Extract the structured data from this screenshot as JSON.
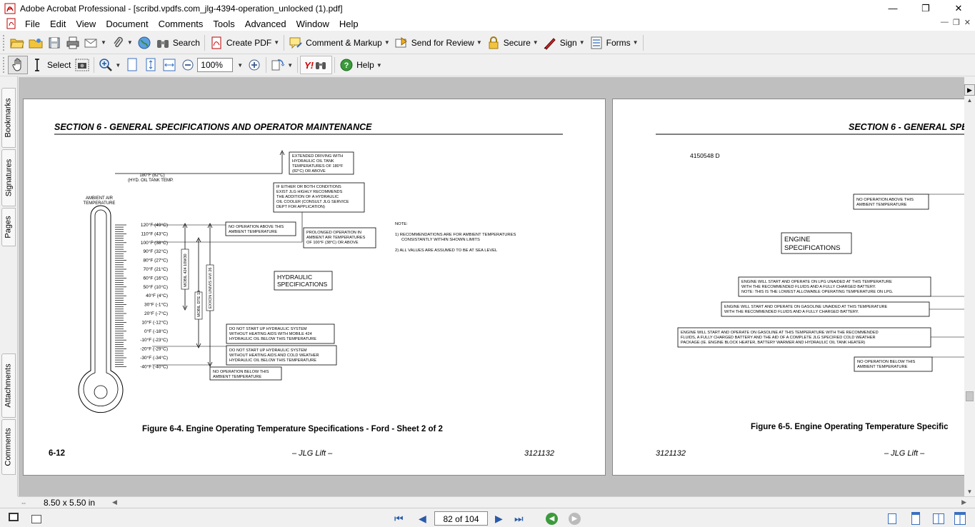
{
  "window": {
    "title": "Adobe Acrobat Professional - [scribd.vpdfs.com_jlg-4394-operation_unlocked (1).pdf]",
    "minimize": "—",
    "maximize": "❐",
    "close": "✕"
  },
  "menu": [
    "File",
    "Edit",
    "View",
    "Document",
    "Comments",
    "Tools",
    "Advanced",
    "Window",
    "Help"
  ],
  "toolbar1": {
    "search": "Search",
    "create_pdf": "Create PDF",
    "comment_markup": "Comment & Markup",
    "send_review": "Send for Review",
    "secure": "Secure",
    "sign": "Sign",
    "forms": "Forms"
  },
  "toolbar2": {
    "select": "Select",
    "zoom": "100%",
    "help": "Help"
  },
  "side_tabs": [
    "Bookmarks",
    "Signatures",
    "Pages",
    "Attachments",
    "Comments"
  ],
  "status": {
    "page_size": "8.50 x 5.50 in",
    "page_indicator": "82 of 104"
  },
  "page_left": {
    "header": "SECTION 6 - GENERAL SPECIFICATIONS AND OPERATOR MAINTENANCE",
    "hyd_temp_line1": "180°F (82°C)",
    "hyd_temp_line2": "(HYD. OIL TANK TEMP.",
    "ambient_label1": "AMBIENT AIR",
    "ambient_label2": "TEMPERATURE",
    "box_extended": [
      "EXTENDED DRIVING WITH",
      "HYDRAULIC OIL TANK",
      "TEMPERATURES OF 180°F",
      "(82°C) OR ABOVE"
    ],
    "box_either": [
      "IF EITHER OR BOTH CONDITIONS",
      "EXIST JLG HIGHLY RECOMMENDS",
      "THE ADDITION OF A HYDRAULIC",
      "OIL COOLER (CONSULT JLG SERVICE",
      "DEPT FOR APPLICATION)"
    ],
    "box_no_op_above": [
      "NO OPERATION ABOVE THIS",
      "AMBIENT TEMPERATURE"
    ],
    "box_prolonged": [
      "PROLONGED OPERATION IN",
      "AMBIENT AIR TEMPERATURES",
      "OF 100°F (38°C) OR ABOVE"
    ],
    "box_hydraulic": [
      "HYDRAULIC",
      "SPECIFICATIONS"
    ],
    "box_mobile424": [
      "DO NOT START UP HYDRAULIC SYSTEM",
      "WITHOUT HEATING AIDS WITH MOBILE 424",
      "HYDRAULIC OIL BELOW THIS TEMPERATURE"
    ],
    "box_coldweather": [
      "DO NOT START UP HYDRAULIC SYSTEM",
      "WITHOUT HEATING AIDS AND COLD WEATHER",
      "HYDRAULIC OIL BELOW THIS TEMPERATURE"
    ],
    "box_no_op_below": [
      "NO OPERATION BELOW THIS",
      "AMBIENT TEMPERATURE"
    ],
    "bar_labels": [
      "MOBIL 424 10W30",
      "MOBIL DTE 13",
      "EXXON UNIVIS HVI 26"
    ],
    "note_title": "NOTE:",
    "notes": [
      "1) RECOMMENDATIONS ARE FOR AMBIENT TEMPERATURES",
      "CONSISTANTLY WITHIN SHOWN LIMITS",
      "2) ALL VALUES ARE ASSUMED TO BE AT SEA LEVEL"
    ],
    "temps": [
      "120°F (49°C)",
      "110°F (43°C)",
      "100°F (38°C)",
      "90°F (32°C)",
      "80°F (27°C)",
      "70°F (21°C)",
      "60°F (16°C)",
      "50°F (10°C)",
      "40°F (4°C)",
      "30°F (-1°C)",
      "20°F (-7°C)",
      "10°F (-12°C)",
      "0°F (-18°C)",
      "-10°F (-23°C)",
      "-20°F (-29°C)",
      "-30°F (-34°C)",
      "-40°F (-40°C)"
    ],
    "caption": "Figure 6-4. Engine Operating Temperature Specifications - Ford - Sheet 2 of 2",
    "footer_left": "6-12",
    "footer_center": "– JLG Lift –",
    "footer_right": "3121132"
  },
  "page_right": {
    "header": "SECTION 6 - GENERAL SPE",
    "part_no": "4150548 D",
    "box_no_op_above": [
      "NO OPERATION ABOVE THIS",
      "AMBIENT TEMPERATURE"
    ],
    "box_engine": [
      "ENGINE",
      "SPECIFICATIONS"
    ],
    "box_lpg": [
      "ENGINE WILL START AND OPERATE ON LPG UNAIDED AT THIS TEMPERATURE",
      "WITH THE RECOMMENDED FLUIDS AND A FULLY CHARGED BATTERY.",
      "NOTE: THIS IS THE LOWEST ALLOWABLE OPERATING TEMPERATURE ON LPG."
    ],
    "box_gasoline": [
      "ENGINE WILL START AND OPERATE ON GASOLINE UNAIDED AT THIS TEMPERATURE",
      "WITH THE RECOMMENDED FLUIDS AND A FULLY CHARGED BATTERY."
    ],
    "box_coldpkg": [
      "ENGINE WILL START AND OPERATE ON GASOLINE AT THIS TEMPERATURE WITH THE RECOMMENDED",
      "FLUIDS, A FULLY CHARGED BATTERY AND THE AID OF A COMPLETE JLG SPECIFIED COLD WEATHER",
      "PACKAGE (IE. ENGINE BLOCK HEATER, BATTERY WARMER AND HYDRAULIC OIL TANK HEATER)"
    ],
    "box_no_op_below": [
      "NO OPERATION BELOW THIS",
      "AMBIENT TEMPERATURE"
    ],
    "caption": "Figure 6-5. Engine Operating Temperature Specific",
    "footer_left": "3121132",
    "footer_center": "– JLG Lift –"
  }
}
